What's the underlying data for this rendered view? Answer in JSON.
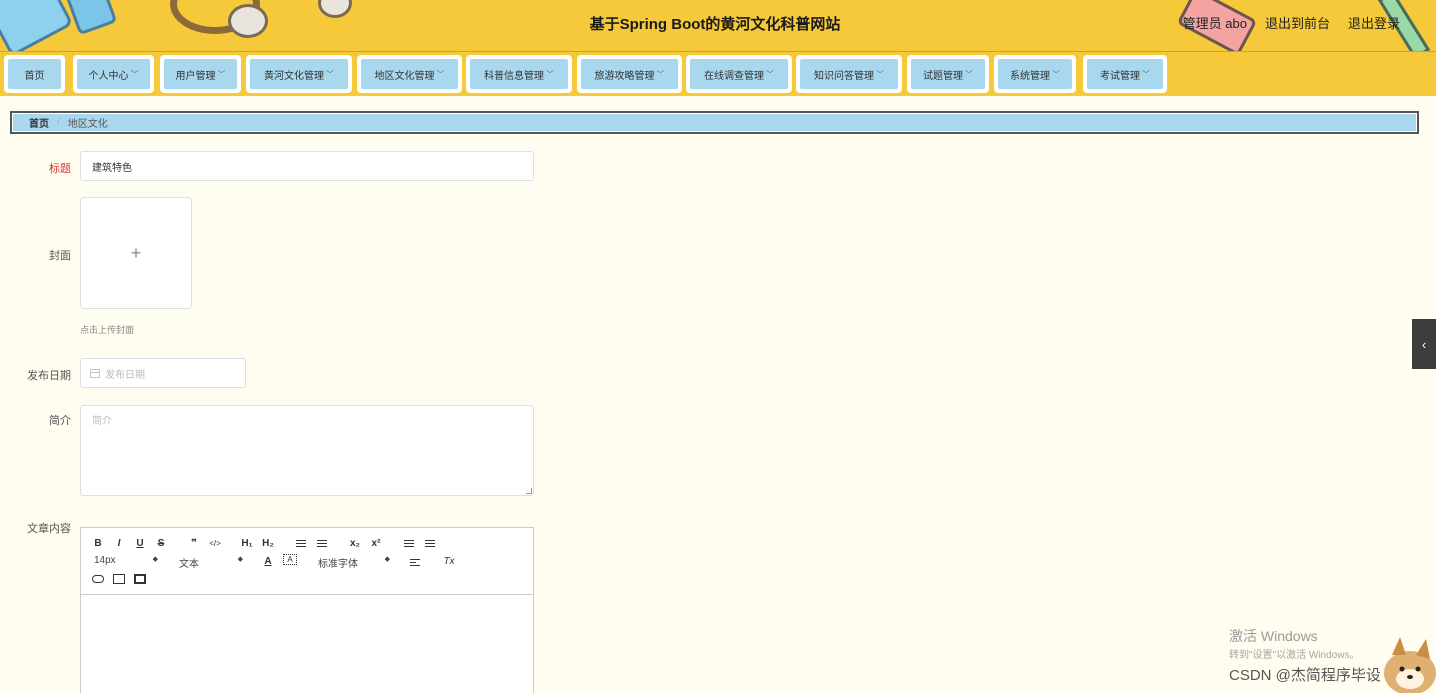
{
  "header": {
    "title": "基于Spring Boot的黄河文化科普网站",
    "user": "管理员 abo",
    "to_front": "退出到前台",
    "logout": "退出登录"
  },
  "nav": {
    "items": [
      {
        "label": "首页",
        "dropdown": false
      },
      {
        "label": "个人中心",
        "dropdown": true
      },
      {
        "label": "用户管理",
        "dropdown": true
      },
      {
        "label": "黄河文化管理",
        "dropdown": true
      },
      {
        "label": "地区文化管理",
        "dropdown": true
      },
      {
        "label": "科普信息管理",
        "dropdown": true
      },
      {
        "label": "旅游攻略管理",
        "dropdown": true
      },
      {
        "label": "在线调查管理",
        "dropdown": true
      },
      {
        "label": "知识问答管理",
        "dropdown": true
      },
      {
        "label": "试题管理",
        "dropdown": true
      },
      {
        "label": "系统管理",
        "dropdown": true
      },
      {
        "label": "考试管理",
        "dropdown": true
      }
    ]
  },
  "breadcrumb": {
    "home": "首页",
    "separator": "/",
    "current": "地区文化"
  },
  "form": {
    "title_label": "标题",
    "title_value": "建筑特色",
    "cover_label": "封面",
    "cover_plus": "+",
    "cover_tip": "点击上传封面",
    "date_label": "发布日期",
    "date_placeholder": "发布日期",
    "intro_label": "简介",
    "intro_placeholder": "简介",
    "content_label": "文章内容"
  },
  "editor": {
    "bold": "B",
    "italic": "I",
    "underline": "U",
    "strike": "S",
    "blockquote": "❞",
    "code": "</>",
    "h1": "H₁",
    "h2": "H₂",
    "subscript": "x₂",
    "superscript": "x²",
    "size_value": "14px",
    "header_value": "文本",
    "color_letter": "A",
    "font_value": "标准字体",
    "clean": "Tx"
  },
  "watermark": {
    "line1": "激活 Windows",
    "line2": "转到\"设置\"以激活 Windows。",
    "csdn": "CSDN @杰简程序毕设"
  },
  "colors": {
    "header_bg": "#f5c93a",
    "nav_item_bg": "#a9d8ee",
    "page_bg": "#fffcf0",
    "required_label": "#dd3333"
  }
}
